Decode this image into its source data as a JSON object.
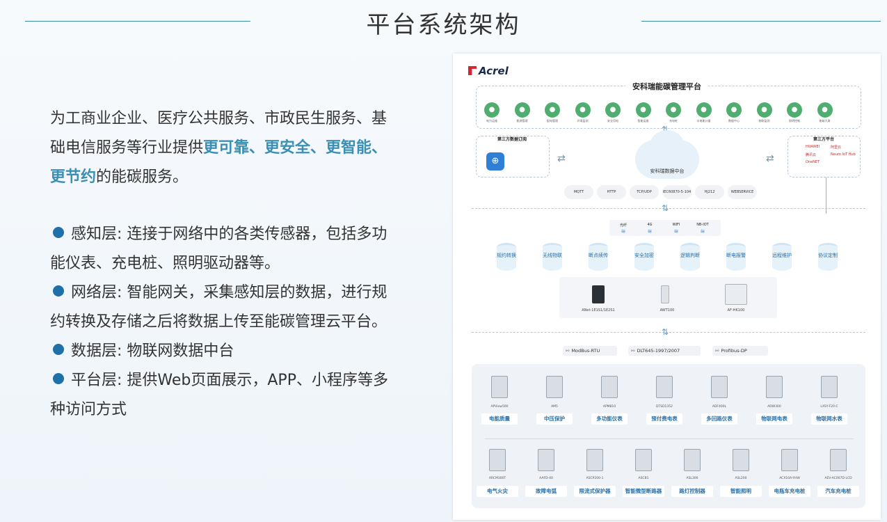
{
  "title": "平台系统架构",
  "intro": {
    "prefix": "为工商业企业、医疗公共服务、市政民生服务、基础电信服务等行业提供",
    "highlight": "更可靠、更安全、更智能、更节约",
    "suffix": "的能碳服务。"
  },
  "layers": [
    {
      "label": "感知层:",
      "text": "连接于网络中的各类传感器，包括多功能仪表、充电桩、照明驱动器等。"
    },
    {
      "label": "网络层:",
      "text": "智能网关，采集感知层的数据，进行规约转换及存储之后将数据上传至能碳管理云平台。"
    },
    {
      "label": "数据层:",
      "text": "物联网数据中台"
    },
    {
      "label": "平台层:",
      "text": "提供Web页面展示，APP、小程序等多种访问方式"
    }
  ],
  "diagram": {
    "logo": "Acrel",
    "platform_title": "安科瑞能碳管理平台",
    "platform_icons": [
      {
        "icon": "leaf-icon",
        "label": "电力运维"
      },
      {
        "icon": "recycle-icon",
        "label": "能源管理"
      },
      {
        "icon": "pin-icon",
        "label": "配电管理"
      },
      {
        "icon": "cloud-icon",
        "label": "环境监测"
      },
      {
        "icon": "grid-icon",
        "label": "安全用电"
      },
      {
        "icon": "cabinet-icon",
        "label": "智能运维"
      },
      {
        "icon": "charger-icon",
        "label": "充电桩"
      },
      {
        "icon": "drop-icon",
        "label": "水电能计量"
      },
      {
        "icon": "db-icon",
        "label": "数据中心"
      },
      {
        "icon": "signal-icon",
        "label": "物联监测"
      },
      {
        "icon": "bulb-icon",
        "label": "照明控制"
      },
      {
        "icon": "screen-icon",
        "label": "能碳大屏"
      }
    ],
    "third_sub_title": "第三方数据订阅",
    "data_center": "安科瑞数据中台",
    "third_platform_title": "第三方平台",
    "third_platforms": [
      "HUAWEI",
      "阿里云",
      "腾讯云",
      "Neuro IoT Hub",
      "OneNET"
    ],
    "protocols": [
      "MQTT",
      "HTTP",
      "TCP/UDP",
      "IEC60870-5-104",
      "HJ212",
      "WEBSERVICE"
    ],
    "networks": [
      "光纤",
      "4G",
      "WIFI",
      "NB-IOT"
    ],
    "gateway_funcs": [
      "规约转换",
      "无线物联",
      "断点续传",
      "安全加密",
      "逻辑判断",
      "断电报警",
      "远程维护",
      "协议定制"
    ],
    "gateways": [
      "ANet-1E1S1/1E2S1",
      "AWT100",
      "AF-HK100"
    ],
    "buses": [
      "ModBus-RTU",
      "DLT645-1997/2007",
      "Profibus-DP"
    ],
    "meters_row1": [
      {
        "model": "APView500",
        "tag": "电能质量"
      },
      {
        "model": "AM5",
        "tag": "中压保护"
      },
      {
        "model": "APM810",
        "tag": "多功能仪表"
      },
      {
        "model": "DTSD1352",
        "tag": "预付费电表"
      },
      {
        "model": "ADF400L",
        "tag": "多回路仪表"
      },
      {
        "model": "ADW300",
        "tag": "物联网电表"
      },
      {
        "model": "LXSY-F20-C",
        "tag": "物联网水表"
      }
    ],
    "meters_row2": [
      {
        "model": "ARCM300T",
        "tag": "电气火灾"
      },
      {
        "model": "AAFD-40",
        "tag": "故障电弧"
      },
      {
        "model": "ASCP200-1",
        "tag": "限流式保护器"
      },
      {
        "model": "ASCB1",
        "tag": "智能微型断路器"
      },
      {
        "model": "ASL300",
        "tag": "路灯控制器"
      },
      {
        "model": "ASL200",
        "tag": "智能照明"
      },
      {
        "model": "ACX10A-YHW",
        "tag": "电瓶车充电桩"
      },
      {
        "model": "AEV-AC007D-LCD",
        "tag": "汽车充电桩"
      }
    ]
  }
}
